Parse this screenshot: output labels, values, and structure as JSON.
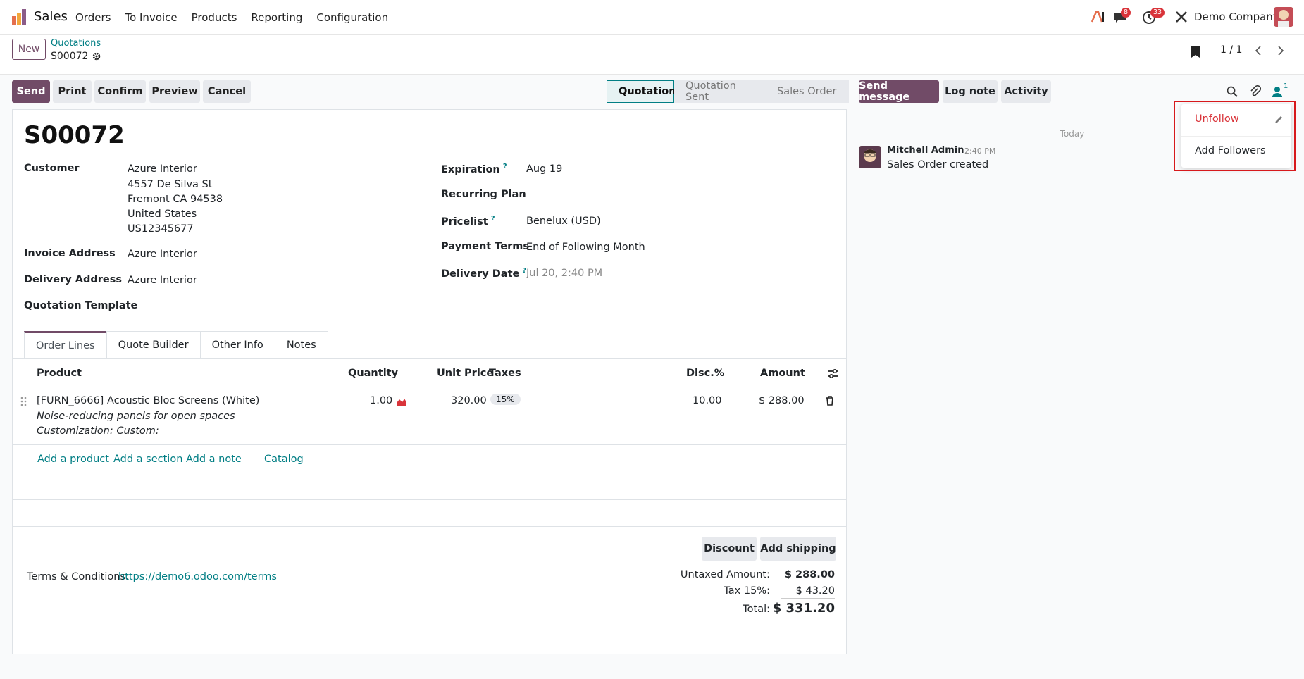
{
  "navbar": {
    "app_name": "Sales",
    "menu": [
      "Orders",
      "To Invoice",
      "Products",
      "Reporting",
      "Configuration"
    ],
    "messages_badge": "8",
    "activities_badge": "33",
    "company": "Demo Company"
  },
  "control": {
    "new_label": "New",
    "breadcrumb_parent": "Quotations",
    "breadcrumb_current": "S00072",
    "pager": "1 / 1"
  },
  "actions": {
    "send": "Send",
    "print": "Print",
    "confirm": "Confirm",
    "preview": "Preview",
    "cancel": "Cancel"
  },
  "statusbar": [
    "Quotation",
    "Quotation Sent",
    "Sales Order"
  ],
  "form": {
    "title": "S00072",
    "customer_label": "Customer",
    "customer_lines": [
      "Azure Interior",
      "4557 De Silva St",
      "Fremont CA 94538",
      "United States",
      "US12345677"
    ],
    "invoice_address_label": "Invoice Address",
    "invoice_address": "Azure Interior",
    "delivery_address_label": "Delivery Address",
    "delivery_address": "Azure Interior",
    "quotation_template_label": "Quotation Template",
    "expiration_label": "Expiration",
    "expiration": "Aug 19",
    "recurring_plan_label": "Recurring Plan",
    "pricelist_label": "Pricelist",
    "pricelist": "Benelux (USD)",
    "payment_terms_label": "Payment Terms",
    "payment_terms": "End of Following Month",
    "delivery_date_label": "Delivery Date",
    "delivery_date": "Jul 20, 2:40 PM",
    "help_mark": "?"
  },
  "tabs": [
    "Order Lines",
    "Quote Builder",
    "Other Info",
    "Notes"
  ],
  "order_lines": {
    "headers": {
      "product": "Product",
      "quantity": "Quantity",
      "unit_price": "Unit Price",
      "taxes": "Taxes",
      "disc": "Disc.%",
      "amount": "Amount"
    },
    "rows": [
      {
        "product": "[FURN_6666] Acoustic Bloc Screens (White)",
        "description": "Noise-reducing panels for open spaces",
        "customization": "Customization: Custom:",
        "quantity": "1.00",
        "unit_price": "320.00",
        "tax": "15%",
        "disc": "10.00",
        "amount": "$ 288.00"
      }
    ],
    "add_product": "Add a product",
    "add_section": "Add a section",
    "add_note": "Add a note",
    "catalog": "Catalog"
  },
  "footer": {
    "discount": "Discount",
    "add_shipping": "Add shipping",
    "terms_label": "Terms & Conditions:",
    "terms_link": "https://demo6.odoo.com/terms",
    "untaxed_label": "Untaxed Amount:",
    "untaxed": "$ 288.00",
    "tax_label": "Tax 15%:",
    "tax": "$ 43.20",
    "total_label": "Total:",
    "total": "$ 331.20"
  },
  "chatter": {
    "send_message": "Send message",
    "log_note": "Log note",
    "activity": "Activity",
    "followers_count": "1",
    "today": "Today",
    "message": {
      "author": "Mitchell Admin",
      "time": "2:40 PM",
      "body": "Sales Order created"
    }
  },
  "followers_dropdown": {
    "unfollow": "Unfollow",
    "add_followers": "Add Followers"
  },
  "colors": {
    "brand": "#714b67",
    "link": "#017e84",
    "danger": "#d9343a"
  }
}
